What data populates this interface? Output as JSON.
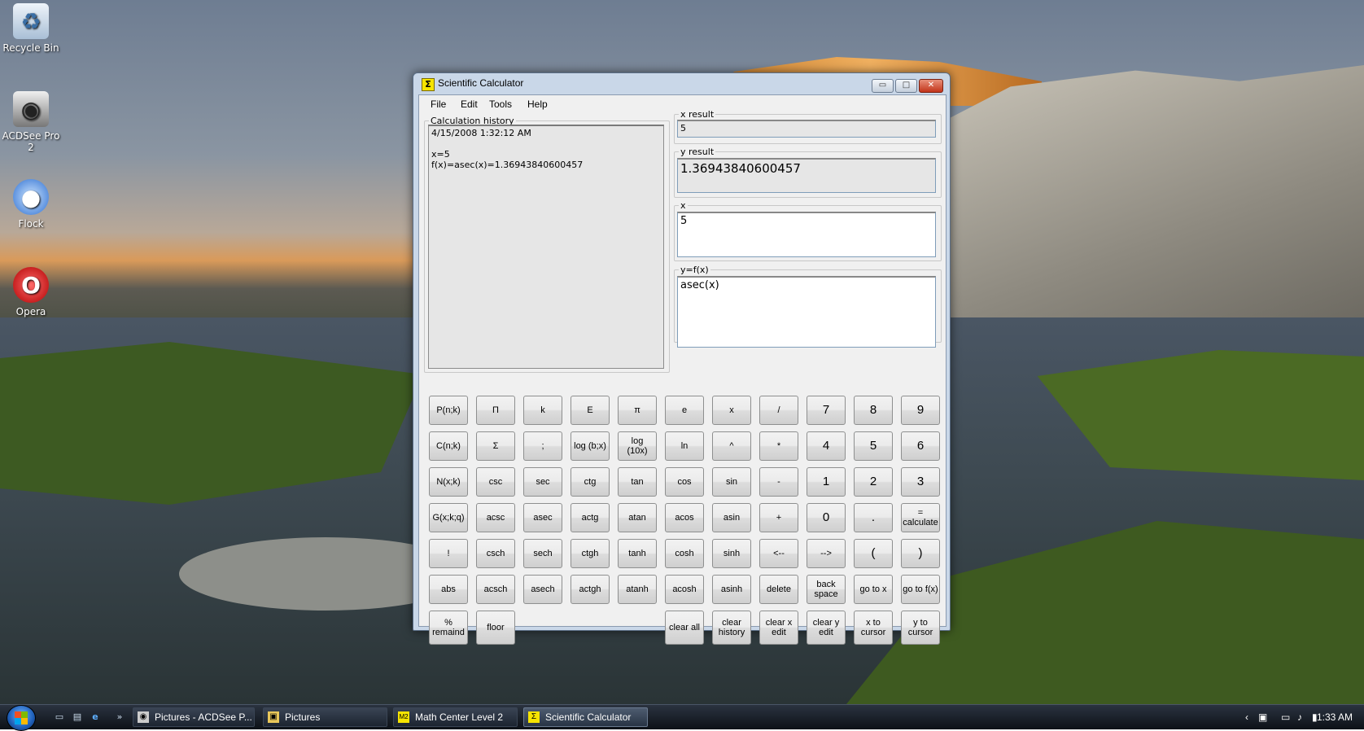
{
  "desktop": {
    "icons": [
      {
        "label": "Recycle Bin",
        "icon": "recycle-bin-icon"
      },
      {
        "label": "ACDSee Pro 2",
        "icon": "acdsee-icon"
      },
      {
        "label": "Flock",
        "icon": "flock-icon"
      },
      {
        "label": "Opera",
        "icon": "opera-icon"
      }
    ]
  },
  "window": {
    "title": "Scientific Calculator",
    "controls": {
      "minimize": "▭",
      "maximize": "□",
      "close": "✕"
    }
  },
  "menu": [
    "File",
    "Edit",
    "Tools",
    "Help"
  ],
  "history": {
    "label": "Calculation history",
    "text": "4/15/2008 1:32:12 AM\n\nx=5\nf(x)=asec(x)=1.36943840600457"
  },
  "x_result": {
    "label": "x result",
    "value": "5"
  },
  "y_result": {
    "label": "y result",
    "value": "1.36943840600457"
  },
  "x_input": {
    "label": "x",
    "value": "5"
  },
  "fx_input": {
    "label": "y=f(x)",
    "value": "asec(x)"
  },
  "keys": [
    [
      "P(n;k)",
      "Π",
      "k",
      "E",
      "π",
      "e",
      "x",
      "/",
      "7",
      "8",
      "9"
    ],
    [
      "C(n;k)",
      "Σ",
      ";",
      "log (b;x)",
      "log\n(10x)",
      "ln",
      "^",
      "*",
      "4",
      "5",
      "6"
    ],
    [
      "N(x;k)",
      "csc",
      "sec",
      "ctg",
      "tan",
      "cos",
      "sin",
      "-",
      "1",
      "2",
      "3"
    ],
    [
      "G(x;k;q)",
      "acsc",
      "asec",
      "actg",
      "atan",
      "acos",
      "asin",
      "+",
      "0",
      ".",
      "=\ncalculate"
    ],
    [
      "!",
      "csch",
      "sech",
      "ctgh",
      "tanh",
      "cosh",
      "sinh",
      "<--",
      "-->",
      "(",
      ")"
    ],
    [
      "abs",
      "acsch",
      "asech",
      "actgh",
      "atanh",
      "acosh",
      "asinh",
      "delete",
      "back\nspace",
      "go to x",
      "go to f(x)"
    ]
  ],
  "last_row": {
    "left": [
      "%\nremaind",
      "floor"
    ],
    "right": [
      "clear all",
      "clear\nhistory",
      "clear x\nedit",
      "clear y\nedit",
      "x to\ncursor",
      "y to\ncursor"
    ]
  },
  "taskbar": {
    "tasks": [
      {
        "label": "Pictures - ACDSee P...",
        "icon": "acdsee-task-icon"
      },
      {
        "label": "Pictures",
        "icon": "folder-task-icon"
      },
      {
        "label": "Math Center Level 2",
        "icon": "m2-task-icon"
      },
      {
        "label": "Scientific Calculator",
        "icon": "sigma-task-icon"
      }
    ],
    "clock": "1:33 AM"
  }
}
